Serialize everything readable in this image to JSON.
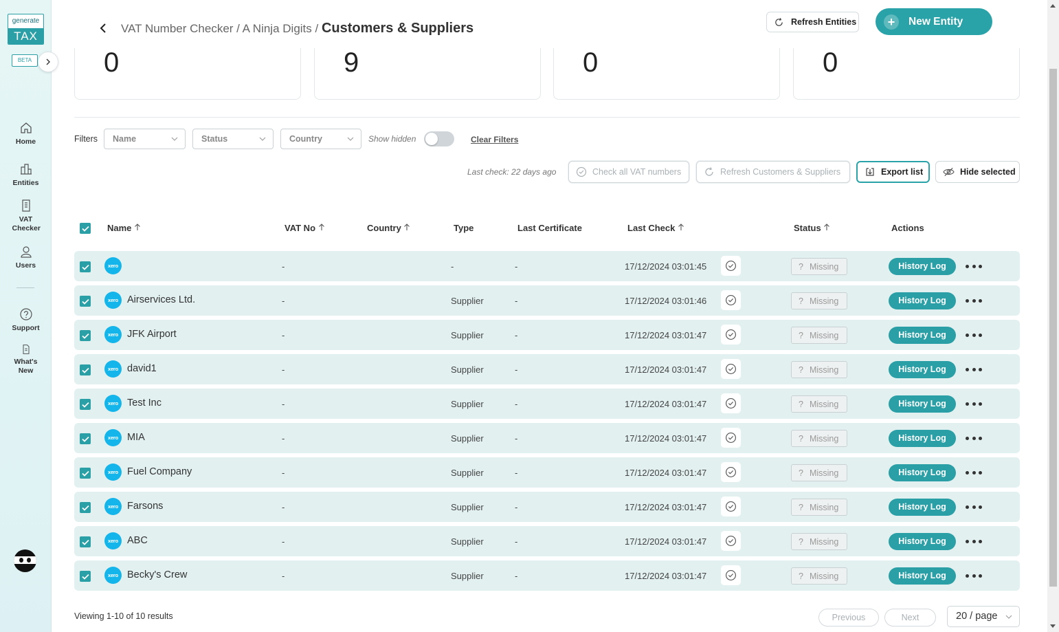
{
  "sidebar": {
    "logo_top": "generate",
    "logo_bottom": "TAX",
    "beta": "BETA",
    "items": [
      {
        "label": "Home"
      },
      {
        "label": "Entities"
      },
      {
        "label": "VAT Checker"
      },
      {
        "label": "Users"
      },
      {
        "label": "Support"
      },
      {
        "label": "What's New"
      }
    ]
  },
  "header": {
    "breadcrumb_parent": "VAT Number Checker / A Ninja Digits / ",
    "breadcrumb_current": "Customers & Suppliers",
    "refresh_entities": "Refresh Entities",
    "new_entity": "New Entity"
  },
  "stats": [
    "0",
    "9",
    "0",
    "0"
  ],
  "filters": {
    "label": "Filters",
    "name_placeholder": "Name",
    "status_placeholder": "Status",
    "country_placeholder": "Country",
    "show_hidden": "Show hidden",
    "clear": "Clear Filters"
  },
  "actions": {
    "last_check": "Last check: 22 days ago",
    "check_all": "Check all VAT numbers",
    "refresh_cs": "Refresh Customers & Suppliers",
    "export": "Export list",
    "hide_selected": "Hide selected"
  },
  "table": {
    "columns": [
      "Name",
      "VAT No",
      "Country",
      "Type",
      "Last Certificate",
      "Last Check",
      "Status",
      "Actions"
    ],
    "xero_label": "xero",
    "status_label": "Missing",
    "history_label": "History Log",
    "rows": [
      {
        "name": "",
        "vat": "-",
        "type": "-",
        "cert": "-",
        "date": "17/12/2024 03:01:45"
      },
      {
        "name": "Airservices Ltd.",
        "vat": "-",
        "type": "Supplier",
        "cert": "-",
        "date": "17/12/2024 03:01:46"
      },
      {
        "name": "JFK Airport",
        "vat": "-",
        "type": "Supplier",
        "cert": "-",
        "date": "17/12/2024 03:01:47"
      },
      {
        "name": "david1",
        "vat": "-",
        "type": "Supplier",
        "cert": "-",
        "date": "17/12/2024 03:01:47"
      },
      {
        "name": "Test Inc",
        "vat": "-",
        "type": "Supplier",
        "cert": "-",
        "date": "17/12/2024 03:01:47"
      },
      {
        "name": "MIA",
        "vat": "-",
        "type": "Supplier",
        "cert": "-",
        "date": "17/12/2024 03:01:47"
      },
      {
        "name": "Fuel Company",
        "vat": "-",
        "type": "Supplier",
        "cert": "-",
        "date": "17/12/2024 03:01:47"
      },
      {
        "name": "Farsons",
        "vat": "-",
        "type": "Supplier",
        "cert": "-",
        "date": "17/12/2024 03:01:47"
      },
      {
        "name": "ABC",
        "vat": "-",
        "type": "Supplier",
        "cert": "-",
        "date": "17/12/2024 03:01:47"
      },
      {
        "name": "Becky's Crew",
        "vat": "-",
        "type": "Supplier",
        "cert": "-",
        "date": "17/12/2024 03:01:47"
      }
    ]
  },
  "footer": {
    "viewing": "Viewing 1-10 of 10 results",
    "previous": "Previous",
    "next": "Next",
    "page_size": "20 / page"
  },
  "colors": {
    "accent": "#2aa3a8",
    "row_bg": "#e2f0ef",
    "xero": "#13b5ea"
  }
}
